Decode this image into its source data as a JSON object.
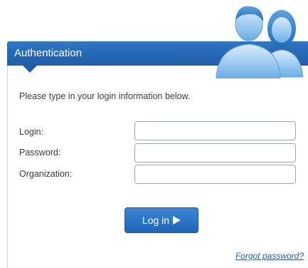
{
  "header": {
    "title": "Authentication"
  },
  "form": {
    "instructions": "Please type in your login information below.",
    "fields": [
      {
        "label": "Login:",
        "value": ""
      },
      {
        "label": "Password:",
        "value": ""
      },
      {
        "label": "Organization:",
        "value": ""
      }
    ],
    "submit_label": "Log in",
    "submit_icon": "play-arrow-icon",
    "forgot_label": "Forgot password?"
  },
  "colors": {
    "accent": "#1e5ea8",
    "link": "#2a5d99"
  },
  "icons": {
    "header_illustration": "users-icon"
  }
}
